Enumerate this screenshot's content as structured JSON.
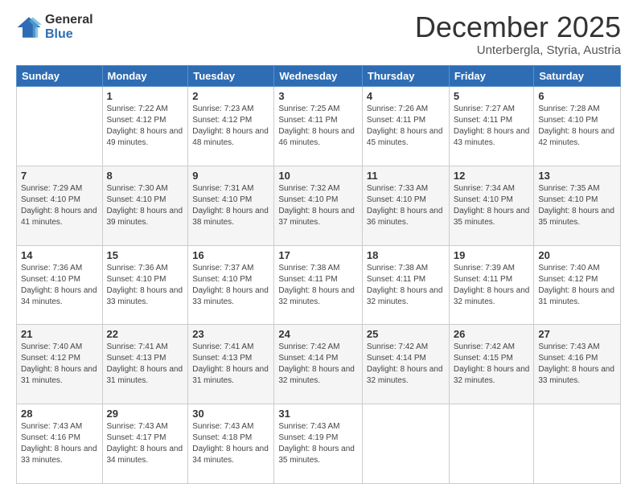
{
  "logo": {
    "general": "General",
    "blue": "Blue"
  },
  "header": {
    "month": "December 2025",
    "location": "Unterbergla, Styria, Austria"
  },
  "weekdays": [
    "Sunday",
    "Monday",
    "Tuesday",
    "Wednesday",
    "Thursday",
    "Friday",
    "Saturday"
  ],
  "weeks": [
    [
      {
        "day": "",
        "sunrise": "",
        "sunset": "",
        "daylight": ""
      },
      {
        "day": "1",
        "sunrise": "Sunrise: 7:22 AM",
        "sunset": "Sunset: 4:12 PM",
        "daylight": "Daylight: 8 hours and 49 minutes."
      },
      {
        "day": "2",
        "sunrise": "Sunrise: 7:23 AM",
        "sunset": "Sunset: 4:12 PM",
        "daylight": "Daylight: 8 hours and 48 minutes."
      },
      {
        "day": "3",
        "sunrise": "Sunrise: 7:25 AM",
        "sunset": "Sunset: 4:11 PM",
        "daylight": "Daylight: 8 hours and 46 minutes."
      },
      {
        "day": "4",
        "sunrise": "Sunrise: 7:26 AM",
        "sunset": "Sunset: 4:11 PM",
        "daylight": "Daylight: 8 hours and 45 minutes."
      },
      {
        "day": "5",
        "sunrise": "Sunrise: 7:27 AM",
        "sunset": "Sunset: 4:11 PM",
        "daylight": "Daylight: 8 hours and 43 minutes."
      },
      {
        "day": "6",
        "sunrise": "Sunrise: 7:28 AM",
        "sunset": "Sunset: 4:10 PM",
        "daylight": "Daylight: 8 hours and 42 minutes."
      }
    ],
    [
      {
        "day": "7",
        "sunrise": "Sunrise: 7:29 AM",
        "sunset": "Sunset: 4:10 PM",
        "daylight": "Daylight: 8 hours and 41 minutes."
      },
      {
        "day": "8",
        "sunrise": "Sunrise: 7:30 AM",
        "sunset": "Sunset: 4:10 PM",
        "daylight": "Daylight: 8 hours and 39 minutes."
      },
      {
        "day": "9",
        "sunrise": "Sunrise: 7:31 AM",
        "sunset": "Sunset: 4:10 PM",
        "daylight": "Daylight: 8 hours and 38 minutes."
      },
      {
        "day": "10",
        "sunrise": "Sunrise: 7:32 AM",
        "sunset": "Sunset: 4:10 PM",
        "daylight": "Daylight: 8 hours and 37 minutes."
      },
      {
        "day": "11",
        "sunrise": "Sunrise: 7:33 AM",
        "sunset": "Sunset: 4:10 PM",
        "daylight": "Daylight: 8 hours and 36 minutes."
      },
      {
        "day": "12",
        "sunrise": "Sunrise: 7:34 AM",
        "sunset": "Sunset: 4:10 PM",
        "daylight": "Daylight: 8 hours and 35 minutes."
      },
      {
        "day": "13",
        "sunrise": "Sunrise: 7:35 AM",
        "sunset": "Sunset: 4:10 PM",
        "daylight": "Daylight: 8 hours and 35 minutes."
      }
    ],
    [
      {
        "day": "14",
        "sunrise": "Sunrise: 7:36 AM",
        "sunset": "Sunset: 4:10 PM",
        "daylight": "Daylight: 8 hours and 34 minutes."
      },
      {
        "day": "15",
        "sunrise": "Sunrise: 7:36 AM",
        "sunset": "Sunset: 4:10 PM",
        "daylight": "Daylight: 8 hours and 33 minutes."
      },
      {
        "day": "16",
        "sunrise": "Sunrise: 7:37 AM",
        "sunset": "Sunset: 4:10 PM",
        "daylight": "Daylight: 8 hours and 33 minutes."
      },
      {
        "day": "17",
        "sunrise": "Sunrise: 7:38 AM",
        "sunset": "Sunset: 4:11 PM",
        "daylight": "Daylight: 8 hours and 32 minutes."
      },
      {
        "day": "18",
        "sunrise": "Sunrise: 7:38 AM",
        "sunset": "Sunset: 4:11 PM",
        "daylight": "Daylight: 8 hours and 32 minutes."
      },
      {
        "day": "19",
        "sunrise": "Sunrise: 7:39 AM",
        "sunset": "Sunset: 4:11 PM",
        "daylight": "Daylight: 8 hours and 32 minutes."
      },
      {
        "day": "20",
        "sunrise": "Sunrise: 7:40 AM",
        "sunset": "Sunset: 4:12 PM",
        "daylight": "Daylight: 8 hours and 31 minutes."
      }
    ],
    [
      {
        "day": "21",
        "sunrise": "Sunrise: 7:40 AM",
        "sunset": "Sunset: 4:12 PM",
        "daylight": "Daylight: 8 hours and 31 minutes."
      },
      {
        "day": "22",
        "sunrise": "Sunrise: 7:41 AM",
        "sunset": "Sunset: 4:13 PM",
        "daylight": "Daylight: 8 hours and 31 minutes."
      },
      {
        "day": "23",
        "sunrise": "Sunrise: 7:41 AM",
        "sunset": "Sunset: 4:13 PM",
        "daylight": "Daylight: 8 hours and 31 minutes."
      },
      {
        "day": "24",
        "sunrise": "Sunrise: 7:42 AM",
        "sunset": "Sunset: 4:14 PM",
        "daylight": "Daylight: 8 hours and 32 minutes."
      },
      {
        "day": "25",
        "sunrise": "Sunrise: 7:42 AM",
        "sunset": "Sunset: 4:14 PM",
        "daylight": "Daylight: 8 hours and 32 minutes."
      },
      {
        "day": "26",
        "sunrise": "Sunrise: 7:42 AM",
        "sunset": "Sunset: 4:15 PM",
        "daylight": "Daylight: 8 hours and 32 minutes."
      },
      {
        "day": "27",
        "sunrise": "Sunrise: 7:43 AM",
        "sunset": "Sunset: 4:16 PM",
        "daylight": "Daylight: 8 hours and 33 minutes."
      }
    ],
    [
      {
        "day": "28",
        "sunrise": "Sunrise: 7:43 AM",
        "sunset": "Sunset: 4:16 PM",
        "daylight": "Daylight: 8 hours and 33 minutes."
      },
      {
        "day": "29",
        "sunrise": "Sunrise: 7:43 AM",
        "sunset": "Sunset: 4:17 PM",
        "daylight": "Daylight: 8 hours and 34 minutes."
      },
      {
        "day": "30",
        "sunrise": "Sunrise: 7:43 AM",
        "sunset": "Sunset: 4:18 PM",
        "daylight": "Daylight: 8 hours and 34 minutes."
      },
      {
        "day": "31",
        "sunrise": "Sunrise: 7:43 AM",
        "sunset": "Sunset: 4:19 PM",
        "daylight": "Daylight: 8 hours and 35 minutes."
      },
      {
        "day": "",
        "sunrise": "",
        "sunset": "",
        "daylight": ""
      },
      {
        "day": "",
        "sunrise": "",
        "sunset": "",
        "daylight": ""
      },
      {
        "day": "",
        "sunrise": "",
        "sunset": "",
        "daylight": ""
      }
    ]
  ]
}
